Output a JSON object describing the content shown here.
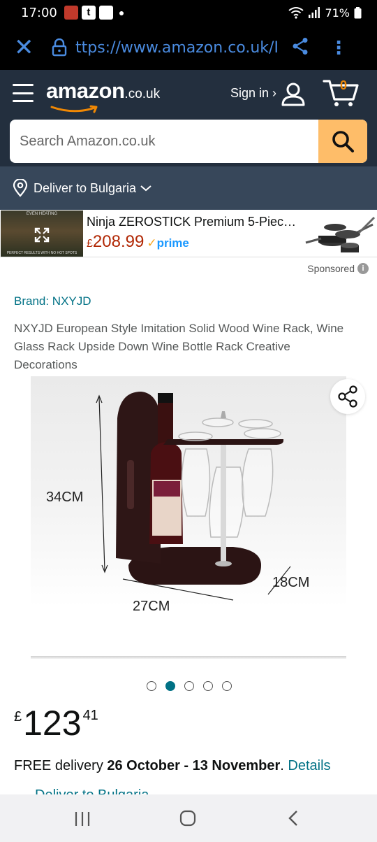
{
  "status_bar": {
    "time": "17:00",
    "battery": "71%",
    "notif_colors": [
      "#c0392b",
      "#ffffff",
      "#ffffff"
    ]
  },
  "browser": {
    "url": "ttps://www.amazon.co.uk/I"
  },
  "header": {
    "logo_word": "amazon",
    "logo_tld": ".co.uk",
    "sign_in": "Sign in ›",
    "cart_count": "0",
    "search_placeholder": "Search Amazon.co.uk"
  },
  "deliver_bar": {
    "label": "Deliver to Bulgaria"
  },
  "ad": {
    "video_caption_top": "EVEN HEATING",
    "video_caption_bottom": "PERFECT RESULTS WITH NO HOT SPOTS",
    "title": "Ninja ZEROSTICK Premium 5-Piec…",
    "currency": "£",
    "price": "208.99",
    "prime": "prime",
    "sponsored": "Sponsored"
  },
  "product": {
    "brand": "Brand: NXYJD",
    "title": "NXYJD European Style Imitation Solid Wood Wine Rack, Wine Glass Rack Upside Down Wine Bottle Rack Creative Decorations",
    "dim_height": "34CM",
    "dim_depth": "18CM",
    "dim_width": "27CM",
    "image_count": 5,
    "active_image": 2,
    "price_currency": "£",
    "price_whole": "123",
    "price_fraction": "41",
    "delivery_prefix": "FREE delivery ",
    "delivery_dates": "26 October - 13 November",
    "delivery_sep": ". ",
    "delivery_link": "Details",
    "deliver_to_partial": "Deliver to Bulgaria"
  },
  "colors": {
    "header_bg": "#232f3e",
    "deliver_bg": "#37475a",
    "search_button": "#febd69",
    "link": "#007185",
    "price_red": "#B12704"
  }
}
